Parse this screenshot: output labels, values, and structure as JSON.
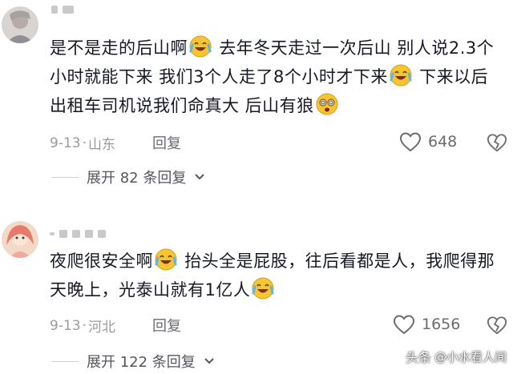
{
  "comments": [
    {
      "text_parts": [
        "是不是走的后山啊",
        "去年冬天走过一次后山 别人说2.3个小时就能下来 我们3个人走了8个小时才下来",
        "下来以后出租车司机说我们命真大 后山有狼"
      ],
      "emojis": [
        "crying-laugh-emoji",
        "crying-laugh-emoji",
        "dizzy-emoji"
      ],
      "date": "9-13",
      "location": "山东",
      "reply_label": "回复",
      "likes": "648",
      "expand_label": "展开 82 条回复"
    },
    {
      "text_parts": [
        "夜爬很安全啊",
        "抬头全是屁股，往后看都是人，我爬得那天晚上，光泰山就有1亿人"
      ],
      "emojis": [
        "crying-laugh-emoji",
        "crying-laugh-emoji"
      ],
      "date": "9-13",
      "location": "河北",
      "reply_label": "回复",
      "likes": "1656",
      "expand_label": "展开 122 条回复"
    }
  ],
  "watermark": {
    "prefix": "头条",
    "handle": "@小水看人间"
  },
  "colors": {
    "text": "#161823",
    "meta": "#9a9aa0",
    "emoji_face": "#f7c531"
  }
}
